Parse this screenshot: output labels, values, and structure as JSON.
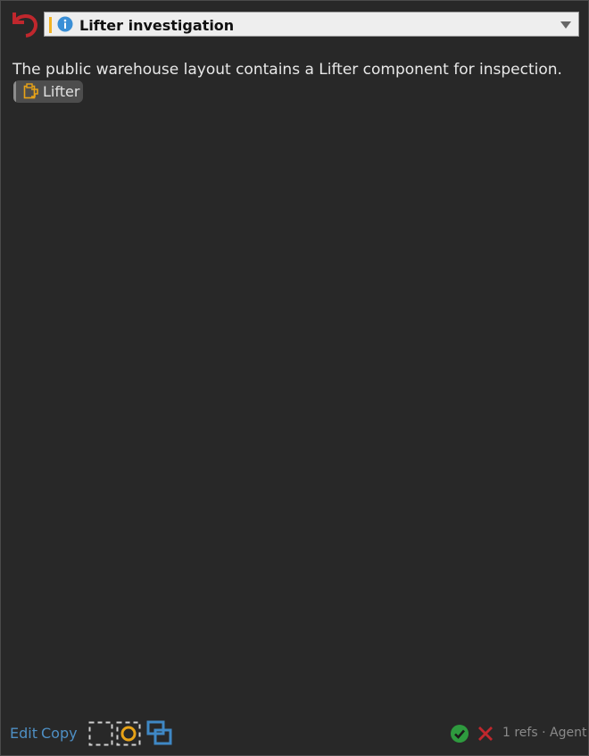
{
  "header": {
    "title": "Lifter investigation",
    "accent_color": "#f2b322",
    "info_icon": "info-icon",
    "dropdown_icon": "chevron-down-icon"
  },
  "body": {
    "description": "The public warehouse layout contains a Lifter component for inspection.",
    "reference_chip": {
      "label": "Lifter",
      "icon": "component-icon"
    }
  },
  "footer": {
    "edit_label": "Edit",
    "copy_label": "Copy",
    "tools": [
      "select-region-icon",
      "select-circle-icon",
      "window-overlay-icon"
    ],
    "status_text": "1 refs · Agent",
    "approve_icon": "check-circle-icon",
    "reject_icon": "close-icon"
  },
  "colors": {
    "link": "#4e8fc4",
    "undo": "#c0272d",
    "approve": "#2e9a3e",
    "reject": "#c0272d",
    "highlight": "#e8a317",
    "overlay_tool": "#3f88c5"
  }
}
